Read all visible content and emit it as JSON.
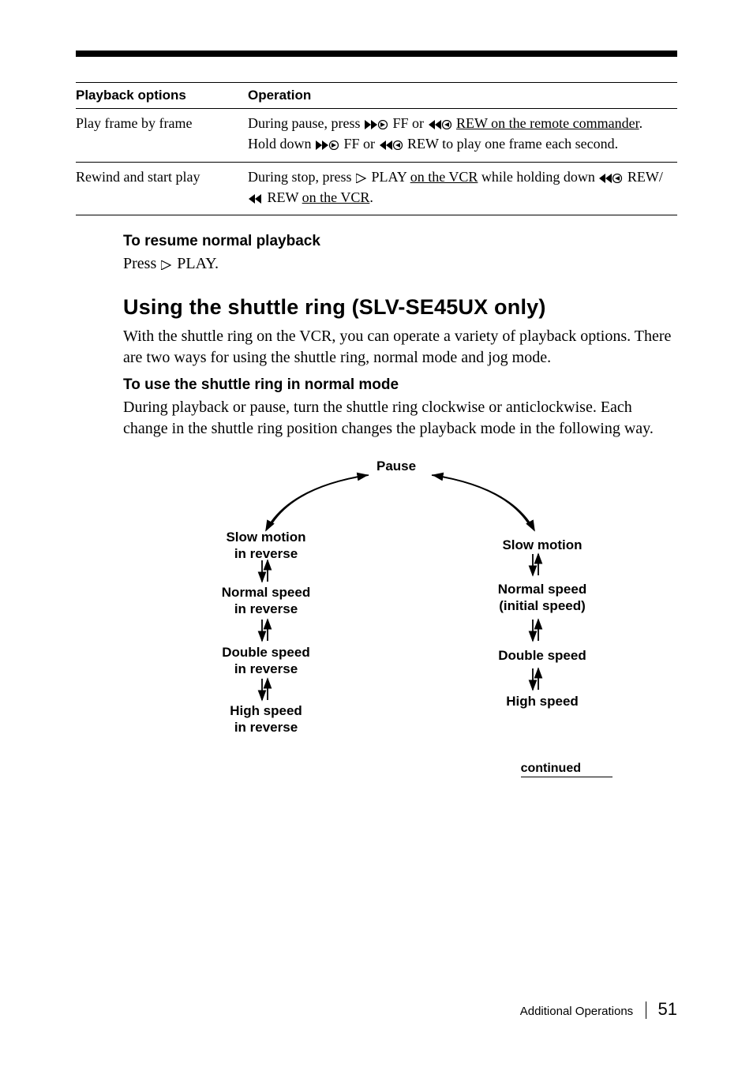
{
  "table": {
    "headers": [
      "Playback options",
      "Operation"
    ],
    "rows": [
      {
        "option": "Play frame by frame",
        "op": {
          "pre1": "During pause, press ",
          "mid1": " FF or ",
          "post1_ul_a": " REW ",
          "post1_ul_b": "on the remote commander",
          "post1_plain": ". Hold down ",
          "mid2": " FF or ",
          "post2": " REW to play one frame each second."
        }
      },
      {
        "option": "Rewind and start play",
        "op": {
          "pre1": "During stop, press ",
          "mid1": " PLAY ",
          "ul1": "on the VCR",
          "mid2": " while holding down ",
          "mid3": " REW/",
          "post1": " REW ",
          "ul2": "on the VCR",
          "end": "."
        }
      }
    ]
  },
  "resume": {
    "heading": "To resume normal playback",
    "body_pre": "Press ",
    "body_post": " PLAY."
  },
  "shuttle": {
    "heading": "Using the shuttle ring (SLV-SE45UX only)",
    "body": "With the shuttle ring on the VCR, you can operate a variety of playback options. There are two ways for using the shuttle ring, normal mode and jog mode.",
    "sub": "To use the shuttle ring in normal mode",
    "body2": "During playback or pause, turn the shuttle ring clockwise or anticlockwise. Each change in the shuttle ring position changes the playback mode in the following way."
  },
  "diagram": {
    "pause": "Pause",
    "slow_rev": "Slow motion\nin reverse",
    "slow": "Slow motion",
    "norm_rev": "Normal speed\nin reverse",
    "norm": "Normal speed\n(initial speed)",
    "dbl_rev": "Double speed\nin reverse",
    "dbl": "Double speed",
    "high_rev": "High speed\nin reverse",
    "high": "High speed"
  },
  "continued": "continued",
  "footer": {
    "section": "Additional Operations",
    "page": "51"
  }
}
